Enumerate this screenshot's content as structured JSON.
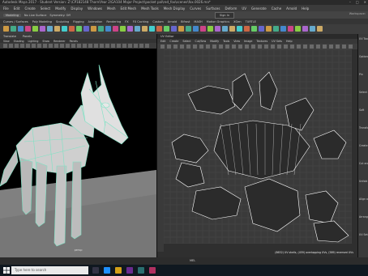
{
  "window": {
    "title": "Autodesk Maya 2017 - Student Version: Z:\\CP182148 Thorn\\Year 2\\GA104 Major Project\\pocket pal\\red_fox\\scenes\\fox.0026.ma*",
    "controls": [
      "–",
      "□",
      "✕"
    ]
  },
  "menubar": {
    "items": [
      "File",
      "Edit",
      "Create",
      "Select",
      "Modify",
      "Display",
      "Windows",
      "Mesh",
      "Edit Mesh",
      "Mesh Tools",
      "Mesh Display",
      "Curves",
      "Surfaces",
      "Deform",
      "UV",
      "Generate",
      "Cache",
      "Arnold",
      "Help"
    ]
  },
  "statusline": {
    "mode": "Modeling",
    "live": "No Live Surface",
    "symmetry": "Symmetry: Off",
    "signin": "Sign In",
    "workspace": "Workspace:"
  },
  "shelf": {
    "tabs": [
      "Curves / Surfaces",
      "Poly Modeling",
      "Sculpting",
      "Rigging",
      "Animation",
      "Rendering",
      "FX",
      "FX Caching",
      "Custom",
      "Arnold",
      "Bifrost",
      "MASH",
      "Motion Graphics",
      "XGen",
      "TURTLE"
    ]
  },
  "viewport": {
    "tabs": [
      "Translate",
      "Panels"
    ],
    "menu": [
      "View",
      "Shading",
      "Lighting",
      "Show",
      "Renderer",
      "Panels"
    ],
    "camera": "persp"
  },
  "uv_editor": {
    "title": "UV Editor",
    "menu": [
      "Edit",
      "Create",
      "Select",
      "Cut/Sew",
      "Modify",
      "Tools",
      "View",
      "Image",
      "Textures",
      "UV Sets",
      "Help"
    ],
    "status": "(8632) UV shells, (459) overlapping UVs, (589) reversed UVs"
  },
  "right_panel": {
    "labels": [
      "UV Toolkit",
      "Options",
      "Pin",
      "Select",
      "Soft",
      "Transform",
      "Create",
      "Cut and Sew",
      "Unfold",
      "Align and Snap",
      "Arrange and Layout",
      "UV Sets"
    ]
  },
  "bottom": {
    "mel": "MEL"
  },
  "taskbar": {
    "search": "Type here to search"
  },
  "colors": {
    "uv_wire": "#ffffff",
    "model_wire": "#7de3c4",
    "grid": "#5a5a5a",
    "floor": "#7a7a7a"
  }
}
